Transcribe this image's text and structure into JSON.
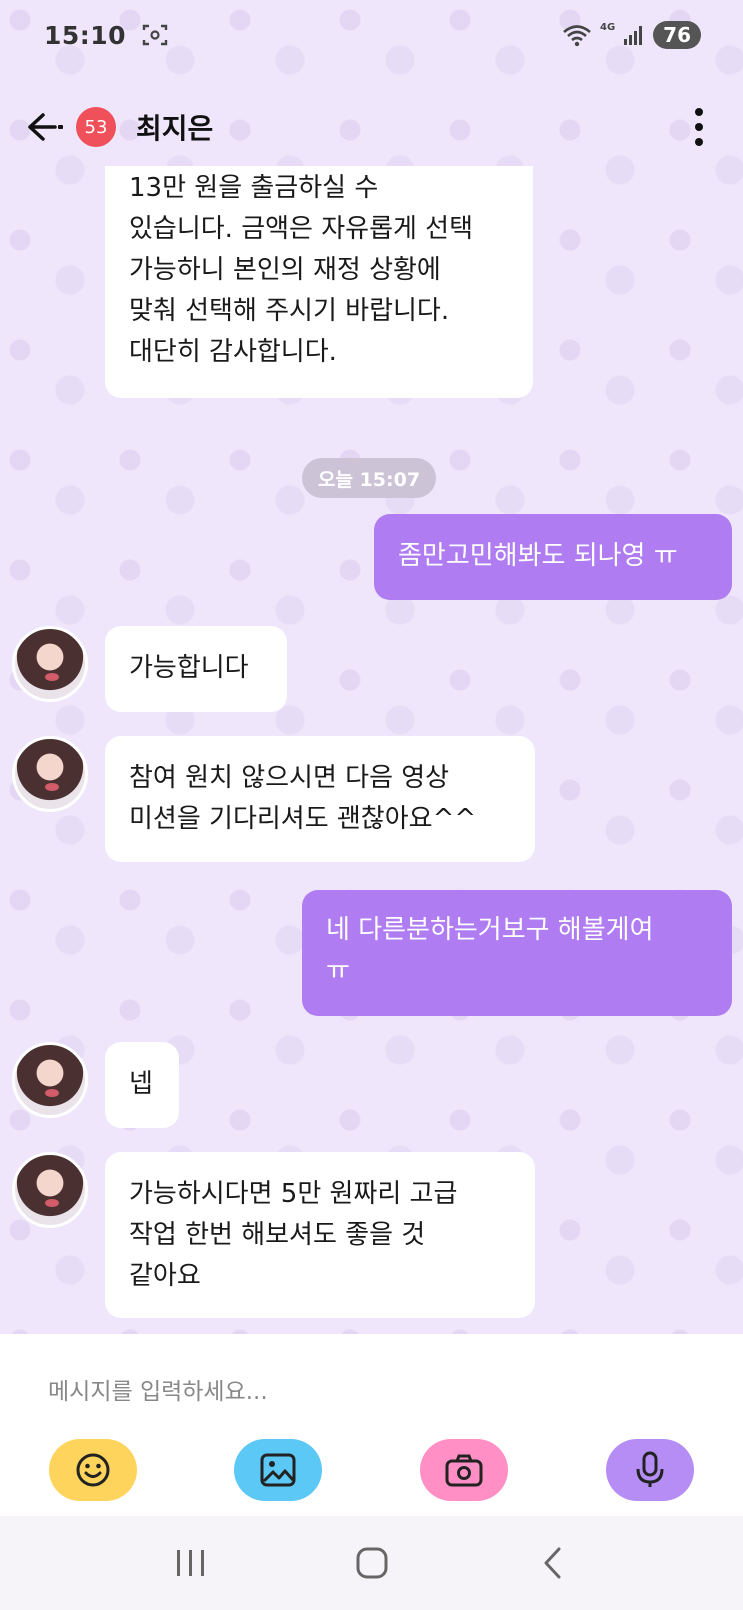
{
  "status_bar": {
    "time": "15:10",
    "network_label": "4G",
    "battery": "76"
  },
  "header": {
    "unread_count": "53",
    "contact_name": "최지은"
  },
  "chat": {
    "date_divider": "오늘 15:07",
    "messages": [
      {
        "direction": "in",
        "text": "13만 원을 출금하실 수\n있습니다. 금액은 자유롭게 선택\n가능하니 본인의 재정 상황에\n맞춰 선택해 주시기 바랍니다.\n대단히 감사합니다."
      },
      {
        "direction": "out",
        "text": "좀만고민해봐도 되나영 ㅠ"
      },
      {
        "direction": "in",
        "text": "가능합니다"
      },
      {
        "direction": "in",
        "text": "참여 원치 않으시면 다음 영상\n미션을 기다리셔도 괜찮아요^^"
      },
      {
        "direction": "out",
        "text": "네 다른분하는거보구 해볼게여\nㅠ"
      },
      {
        "direction": "in",
        "text": "넵"
      },
      {
        "direction": "in",
        "text": "가능하시다면 5만 원짜리 고급\n작업 한번 해보셔도 좋을 것\n같아요"
      }
    ]
  },
  "composer": {
    "placeholder": "메시지를 입력하세요...",
    "tools": [
      {
        "name": "emoji",
        "color": "#ffd45c"
      },
      {
        "name": "image",
        "color": "#5cc8f5"
      },
      {
        "name": "camera",
        "color": "#ff8fc4"
      },
      {
        "name": "microphone",
        "color": "#b58df5"
      }
    ]
  },
  "colors": {
    "background": "#efe6fb",
    "outgoing_bubble": "#b07cf2",
    "incoming_bubble": "#ffffff",
    "badge": "#f0505a"
  }
}
